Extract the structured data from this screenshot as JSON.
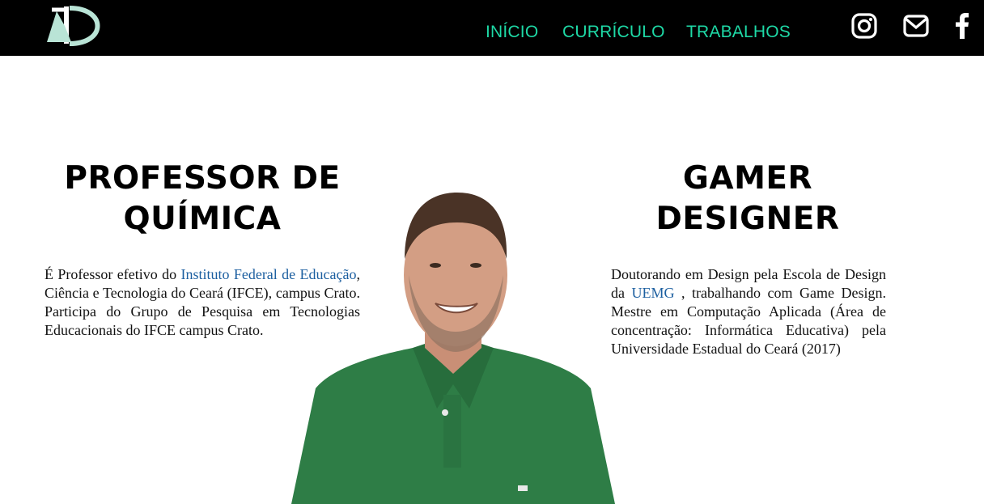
{
  "header": {
    "logo_alt": "KD",
    "nav": [
      {
        "label": "INÍCIO"
      },
      {
        "label": "CURRÍCULO"
      },
      {
        "label": "TRABALHOS"
      }
    ],
    "social": [
      {
        "icon": "instagram-icon"
      },
      {
        "icon": "mail-icon"
      },
      {
        "icon": "facebook-icon"
      }
    ],
    "accent_color": "#1ed9a6",
    "background_color": "#000000"
  },
  "left": {
    "title_line1": "PROFESSOR DE",
    "title_line2": "QUÍMICA",
    "p_before": "É Professor efetivo do ",
    "p_link": "Instituto Federal de Educação",
    "p_after": ", Ciência e Tecnologia do Ceará (IFCE), campus Crato. Participa do Grupo de Pesquisa em Tecnologias Educacionais do IFCE campus Crato."
  },
  "right": {
    "title_line1": "GAMER",
    "title_line2": "DESIGNER",
    "p_before": "Doutorando em Design pela Escola de Design da ",
    "p_link": "UEMG",
    "p_after": " , trabalhando com Game Design. Mestre em Computação Aplicada (Área de concentração: Informática Educativa) pela Universidade Estadual do Ceará (2017)"
  },
  "link_color": "#1c5fa0",
  "shirt_color": "#2e7d46"
}
